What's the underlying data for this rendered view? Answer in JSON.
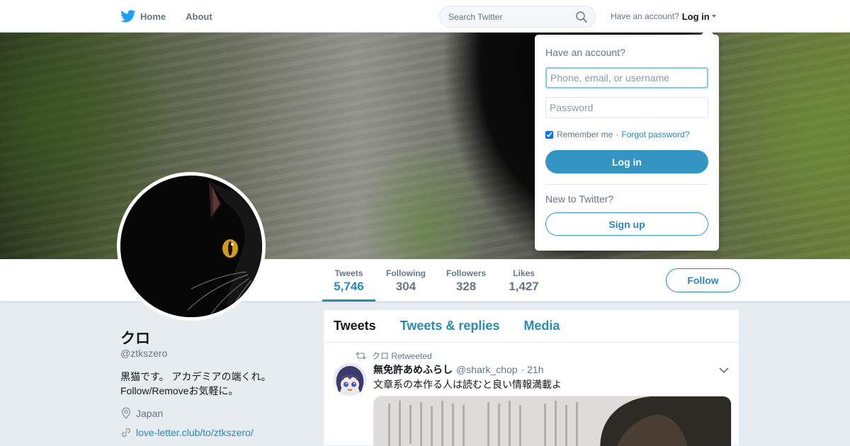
{
  "nav": {
    "home_label": "Home",
    "about_label": "About",
    "search_placeholder": "Search Twitter",
    "have_account": "Have an account?",
    "login_label": "Log in"
  },
  "profile": {
    "name": "クロ",
    "handle": "@ztkszero",
    "bio_line1": "黒猫です。 アカデミアの端くれ。",
    "bio_line2": "Follow/Removeお気軽に。",
    "location": "Japan",
    "website": "love-letter.club/to/ztkszero/"
  },
  "stats": [
    {
      "label": "Tweets",
      "value": "5,746",
      "active": true
    },
    {
      "label": "Following",
      "value": "304",
      "active": false
    },
    {
      "label": "Followers",
      "value": "328",
      "active": false
    },
    {
      "label": "Likes",
      "value": "1,427",
      "active": false
    }
  ],
  "follow_label": "Follow",
  "timeline": {
    "tabs": [
      "Tweets",
      "Tweets & replies",
      "Media"
    ],
    "active_tab": "Tweets",
    "tweet": {
      "retweet_by": "クロ Retweeted",
      "author_name": "無免許あめふらし",
      "author_handle": "@shark_chop",
      "time": "· 21h",
      "text": "文章系の本作る人は読むと良い情報満載よ"
    }
  },
  "login_dropdown": {
    "title": "Have an account?",
    "username_placeholder": "Phone, email, or username",
    "password_placeholder": "Password",
    "remember_label": "Remember me",
    "separator": "·",
    "forgot_label": "Forgot password?",
    "remember_checked": true,
    "login_button": "Log in",
    "new_to_twitter": "New to Twitter?",
    "signup_button": "Sign up"
  },
  "colors": {
    "accent": "#2b8ab4",
    "login_button_bg": "#3495c2",
    "twitter_blue": "#1da1f2",
    "page_bg": "#e6ecf0"
  },
  "icons": {
    "logo": "twitter-bird-icon",
    "search": "search-icon",
    "retweet": "retweet-icon",
    "location": "location-pin-icon",
    "link": "link-icon",
    "tweet_menu": "chevron-down-icon"
  }
}
